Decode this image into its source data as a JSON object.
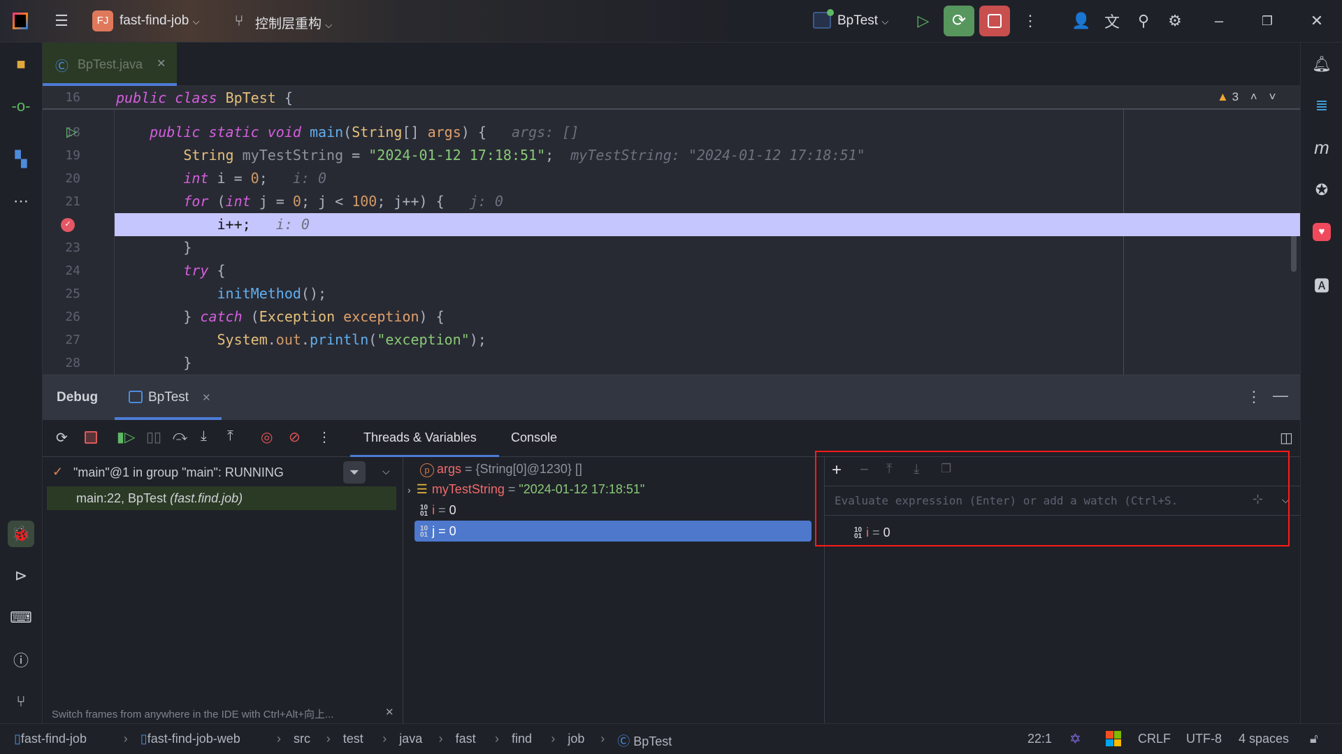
{
  "titlebar": {
    "project_badge": "FJ",
    "project": "fast-find-job",
    "branch": "控制层重构",
    "run_config": "BpTest"
  },
  "editor": {
    "tab": "BpTest.java",
    "warnings": "3",
    "sticky": {
      "line": "16",
      "tokens": [
        [
          "k",
          "public"
        ],
        [
          "p",
          " "
        ],
        [
          "k",
          "class"
        ],
        [
          "p",
          " "
        ],
        [
          "t",
          "BpTest"
        ],
        [
          "p",
          " {"
        ]
      ]
    },
    "lines": [
      {
        "n": "18",
        "tokens": [
          [
            "p",
            "    "
          ],
          [
            "k",
            "public"
          ],
          [
            "p",
            " "
          ],
          [
            "k",
            "static"
          ],
          [
            "p",
            " "
          ],
          [
            "k",
            "void"
          ],
          [
            "p",
            " "
          ],
          [
            "m",
            "main"
          ],
          [
            "p",
            "("
          ],
          [
            "t",
            "String"
          ],
          [
            "p",
            "[] "
          ],
          [
            "a",
            "args"
          ],
          [
            "p",
            ") {   "
          ],
          [
            "h",
            "args: []"
          ]
        ]
      },
      {
        "n": "19",
        "tokens": [
          [
            "p",
            "        "
          ],
          [
            "t",
            "String"
          ],
          [
            "p",
            " "
          ],
          [
            "v",
            "myTestString"
          ],
          [
            "p",
            " = "
          ],
          [
            "s",
            "\"2024-01-12 17:18:51\""
          ],
          [
            "p",
            ";  "
          ],
          [
            "h",
            "myTestString: \"2024-01-12 17:18:51\""
          ]
        ]
      },
      {
        "n": "20",
        "tokens": [
          [
            "p",
            "        "
          ],
          [
            "k",
            "int"
          ],
          [
            "p",
            " i = "
          ],
          [
            "n",
            "0"
          ],
          [
            "p",
            ";   "
          ],
          [
            "h",
            "i: 0"
          ]
        ]
      },
      {
        "n": "21",
        "tokens": [
          [
            "p",
            "        "
          ],
          [
            "k",
            "for"
          ],
          [
            "p",
            " ("
          ],
          [
            "k",
            "int"
          ],
          [
            "p",
            " j = "
          ],
          [
            "n",
            "0"
          ],
          [
            "p",
            "; j < "
          ],
          [
            "n",
            "100"
          ],
          [
            "p",
            "; j++) {   "
          ],
          [
            "h",
            "j: 0"
          ]
        ]
      },
      {
        "n": "22",
        "tokens": [
          [
            "p",
            "            "
          ],
          [
            "d",
            "i++;"
          ],
          [
            "p",
            "   "
          ],
          [
            "h",
            "i: 0"
          ]
        ]
      },
      {
        "n": "23",
        "tokens": [
          [
            "p",
            "        }"
          ]
        ]
      },
      {
        "n": "24",
        "tokens": [
          [
            "p",
            "        "
          ],
          [
            "k",
            "try"
          ],
          [
            "p",
            " {"
          ]
        ]
      },
      {
        "n": "25",
        "tokens": [
          [
            "p",
            "            "
          ],
          [
            "m",
            "initMethod"
          ],
          [
            "p",
            "();"
          ]
        ]
      },
      {
        "n": "26",
        "tokens": [
          [
            "p",
            "        } "
          ],
          [
            "k",
            "catch"
          ],
          [
            "p",
            " ("
          ],
          [
            "t",
            "Exception"
          ],
          [
            "p",
            " "
          ],
          [
            "a",
            "exception"
          ],
          [
            "p",
            ") {"
          ]
        ]
      },
      {
        "n": "27",
        "tokens": [
          [
            "p",
            "            "
          ],
          [
            "t",
            "System"
          ],
          [
            "p",
            "."
          ],
          [
            "n",
            "out"
          ],
          [
            "p",
            "."
          ],
          [
            "m",
            "println"
          ],
          [
            "p",
            "("
          ],
          [
            "s",
            "\"exception\""
          ],
          [
            "p",
            ");"
          ]
        ]
      },
      {
        "n": "28",
        "tokens": [
          [
            "p",
            "        }"
          ]
        ]
      }
    ],
    "current_line": "22"
  },
  "debug": {
    "title": "Debug",
    "session_tab": "BpTest",
    "tabs": [
      "Threads & Variables",
      "Console"
    ],
    "thread": "\"main\"@1 in group \"main\": RUNNING",
    "frame": {
      "location": "main:22, BpTest",
      "package": "(fast.find.job)"
    },
    "variables": [
      {
        "name": "args",
        "eq": " = ",
        "value": "{String[0]@1230} []"
      },
      {
        "name": "myTestString",
        "eq": " = ",
        "value": "\"2024-01-12 17:18:51\""
      },
      {
        "name": "i",
        "eq": " = ",
        "value": "0"
      },
      {
        "name": "j",
        "eq": " = ",
        "value": "0"
      }
    ],
    "watch_placeholder": "Evaluate expression (Enter) or add a watch (Ctrl+S.",
    "watches": [
      {
        "name": "i",
        "eq": " = ",
        "value": "0"
      }
    ],
    "hint": "Switch frames from anywhere in the IDE with Ctrl+Alt+向上..."
  },
  "status": {
    "breadcrumbs": [
      "fast-find-job",
      "fast-find-job-web",
      "src",
      "test",
      "java",
      "fast",
      "find",
      "job",
      "BpTest"
    ],
    "position": "22:1",
    "line_ending": "CRLF",
    "encoding": "UTF-8",
    "indent": "4 spaces"
  },
  "colors": {
    "accent": "#4d7bd6",
    "exec_line": "#c6c6fe",
    "debug_green": "#57965c",
    "stop_red": "#c94f4f",
    "highlight_box": "#ff1a1a"
  }
}
